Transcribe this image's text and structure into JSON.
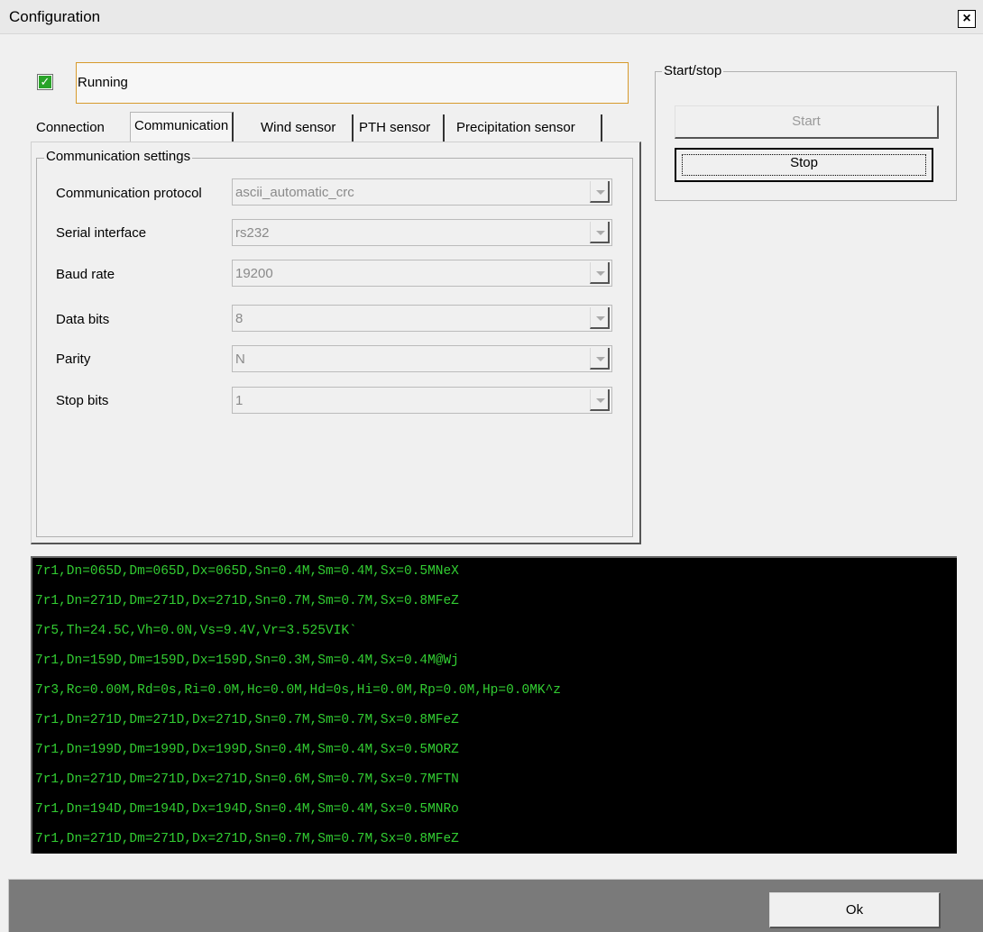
{
  "window": {
    "title": "Configuration",
    "close_glyph": "×"
  },
  "running": {
    "checked": true,
    "label": "Running"
  },
  "tabs": [
    {
      "label": "Connection",
      "active": false
    },
    {
      "label": "Communication",
      "active": true
    },
    {
      "label": "Wind sensor",
      "active": false
    },
    {
      "label": "PTH sensor",
      "active": false
    },
    {
      "label": "Precipitation sensor",
      "active": false
    }
  ],
  "communication_settings": {
    "legend": "Communication settings",
    "fields": [
      {
        "label": "Communication protocol",
        "value": "ascii_automatic_crc"
      },
      {
        "label": "Serial interface",
        "value": "rs232"
      },
      {
        "label": "Baud rate",
        "value": "19200"
      },
      {
        "label": "Data bits",
        "value": "8"
      },
      {
        "label": "Parity",
        "value": "N"
      },
      {
        "label": "Stop bits",
        "value": "1"
      }
    ]
  },
  "start_stop": {
    "legend": "Start/stop",
    "start_label": "Start",
    "stop_label": "Stop"
  },
  "console_lines": [
    "7r1,Dn=065D,Dm=065D,Dx=065D,Sn=0.4M,Sm=0.4M,Sx=0.5MNeX",
    "7r1,Dn=271D,Dm=271D,Dx=271D,Sn=0.7M,Sm=0.7M,Sx=0.8MFeZ",
    "7r5,Th=24.5C,Vh=0.0N,Vs=9.4V,Vr=3.525VIK`",
    "7r1,Dn=159D,Dm=159D,Dx=159D,Sn=0.3M,Sm=0.4M,Sx=0.4M@Wj",
    "7r3,Rc=0.00M,Rd=0s,Ri=0.0M,Hc=0.0M,Hd=0s,Hi=0.0M,Rp=0.0M,Hp=0.0MK^z",
    "7r1,Dn=271D,Dm=271D,Dx=271D,Sn=0.7M,Sm=0.7M,Sx=0.8MFeZ",
    "7r1,Dn=199D,Dm=199D,Dx=199D,Sn=0.4M,Sm=0.4M,Sx=0.5MORZ",
    "7r1,Dn=271D,Dm=271D,Dx=271D,Sn=0.6M,Sm=0.7M,Sx=0.7MFTN",
    "7r1,Dn=194D,Dm=194D,Dx=194D,Sn=0.4M,Sm=0.4M,Sx=0.5MNRo",
    "7r1,Dn=271D,Dm=271D,Dx=271D,Sn=0.7M,Sm=0.7M,Sx=0.8MFeZ"
  ],
  "footer": {
    "ok_label": "Ok"
  },
  "colors": {
    "console_text": "#32cd32",
    "console_bg": "#000000",
    "check_green": "#29a329",
    "running_border": "#d79a2c"
  }
}
